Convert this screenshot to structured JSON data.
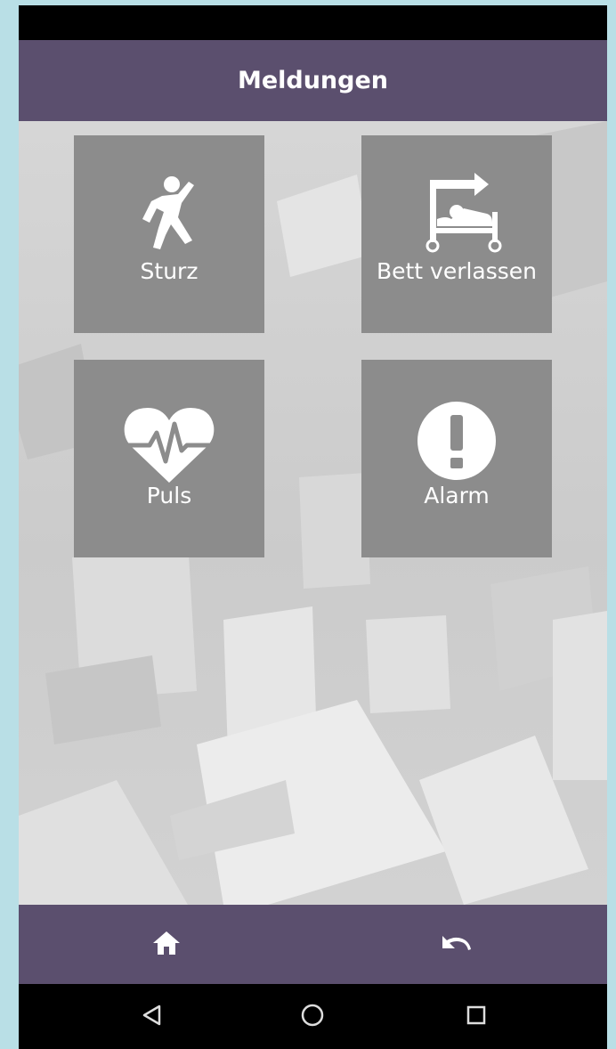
{
  "app_bar": {
    "title": "Meldungen"
  },
  "tiles": [
    {
      "label": "Sturz",
      "icon": "fall-person-icon"
    },
    {
      "label": "Bett verlassen",
      "icon": "leave-bed-icon"
    },
    {
      "label": "Puls",
      "icon": "heart-pulse-icon"
    },
    {
      "label": "Alarm",
      "icon": "alert-icon"
    }
  ],
  "bottom_bar": {
    "home_icon": "home-icon",
    "back_icon": "undo-icon"
  },
  "system_nav": {
    "back": "triangle-back-icon",
    "home": "circle-home-icon",
    "recents": "square-recents-icon"
  },
  "colors": {
    "bar": "#5b4f6e",
    "tile": "#8c8c8c",
    "frame": "#b9dfe6"
  }
}
